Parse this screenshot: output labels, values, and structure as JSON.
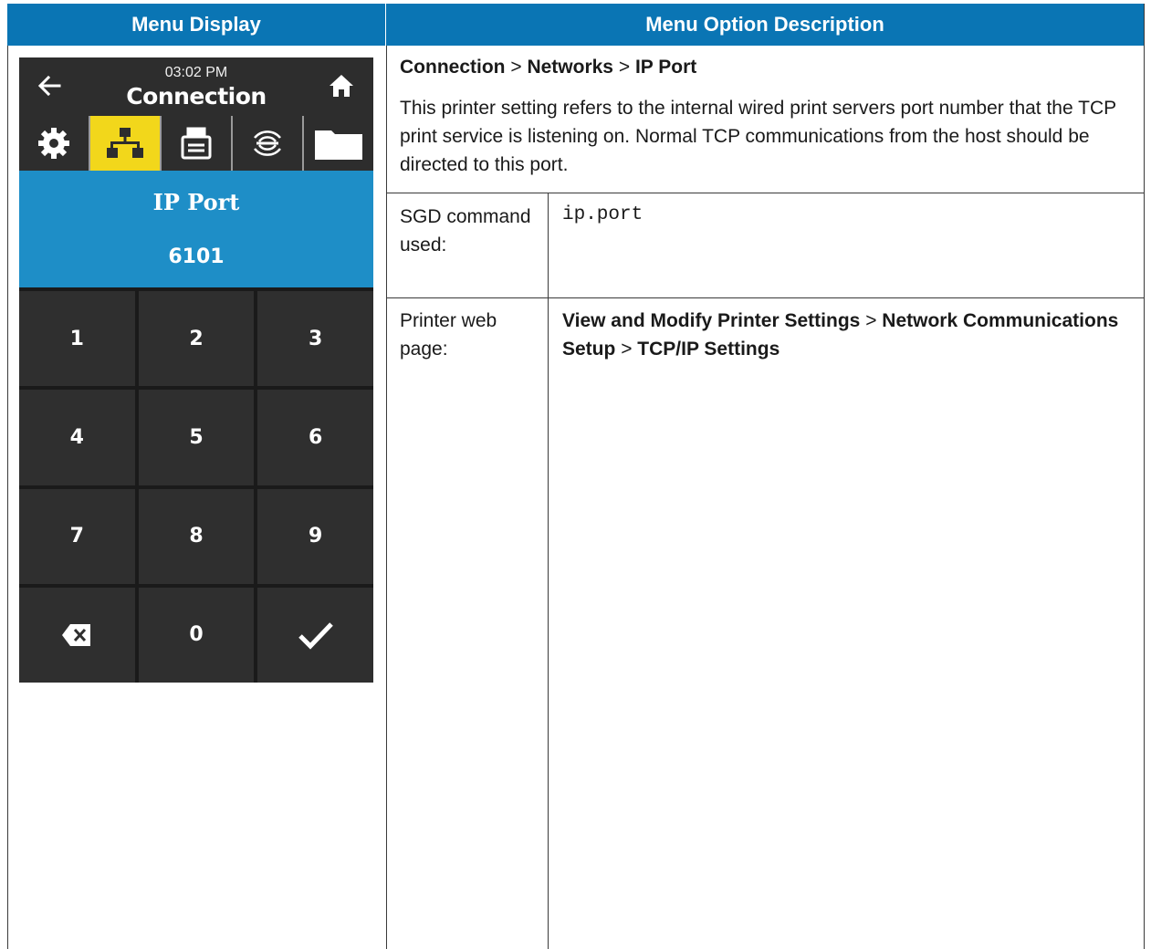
{
  "table": {
    "header_left": "Menu Display",
    "header_right": "Menu Option Description"
  },
  "description": {
    "breadcrumb": [
      "Connection",
      "Networks",
      "IP Port"
    ],
    "separator": ">",
    "text": "This printer setting refers to the internal wired print servers port number that the TCP print service is listening on. Normal TCP communications from the host should be directed to this port.",
    "sgd_label": "SGD command used:",
    "sgd_command": "ip.port",
    "web_label": "Printer web page:",
    "web_path": [
      "View and Modify Printer Settings",
      "Network Communications Setup",
      "TCP/IP Settings"
    ]
  },
  "printer_display": {
    "time": "03:02 PM",
    "title": "Connection",
    "tabs": [
      {
        "icon": "gear-icon",
        "active": false
      },
      {
        "icon": "network-icon",
        "active": true
      },
      {
        "icon": "printer-icon",
        "active": false
      },
      {
        "icon": "rfid-icon",
        "active": false
      },
      {
        "icon": "folder-icon",
        "active": false
      }
    ],
    "field_label": "IP Port",
    "field_value": "6101",
    "keys": [
      "1",
      "2",
      "3",
      "4",
      "5",
      "6",
      "7",
      "8",
      "9",
      "backspace",
      "0",
      "confirm"
    ],
    "active_color": "#f2d71b",
    "highlight_color": "#1e8ec7",
    "header_color": "#0a75b4"
  }
}
